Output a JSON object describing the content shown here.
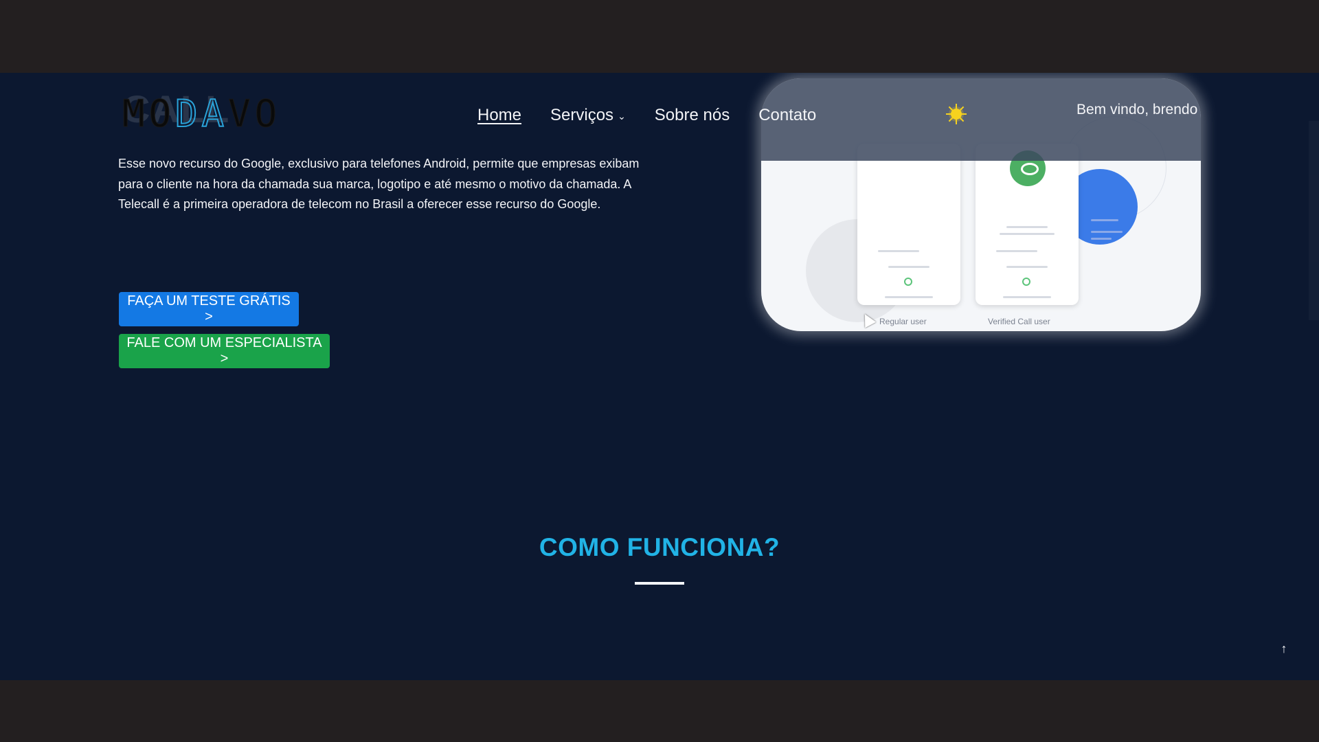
{
  "brand": {
    "logo_text": "MODAVO",
    "logo_ghost_text": "CALL"
  },
  "nav": {
    "items": [
      {
        "label": "Home",
        "active": true
      },
      {
        "label": "Serviços",
        "has_dropdown": true
      },
      {
        "label": "Sobre nós"
      },
      {
        "label": "Contato"
      }
    ],
    "theme_toggle_icon": "sun-icon",
    "welcome_text": "Bem vindo, brendo"
  },
  "hero": {
    "intro_text": "Esse novo recurso do Google, exclusivo para telefones Android, permite que empresas exibam para o cliente na hora da chamada sua marca, logotipo e até mesmo o motivo da chamada. A Telecall é a primeira operadora de telecom no Brasil a oferecer esse recurso do Google.",
    "image": {
      "label_regular": "Regular user",
      "label_verified": "Verified Call user"
    },
    "buttons": {
      "free_trial": "FAÇA UM TESTE GRÁTIS >",
      "specialist": "FALE COM UM ESPECIALISTA >"
    }
  },
  "how_it_works": {
    "title": "COMO FUNCIONA?"
  },
  "scroll_top_icon": "arrow-up-icon",
  "colors": {
    "page_bg": "#0c1830",
    "letterbox": "#231f20",
    "accent_blue": "#1479e4",
    "accent_green": "#1aa34a",
    "title_cyan": "#21b3e6"
  }
}
